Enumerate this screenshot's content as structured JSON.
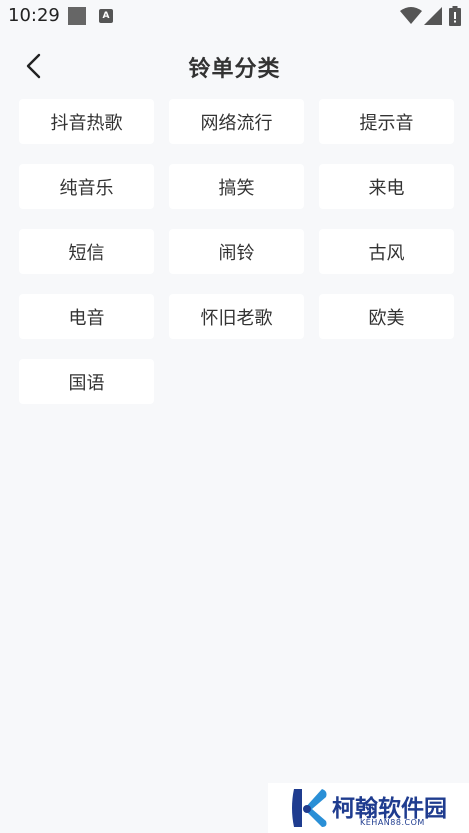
{
  "status_bar": {
    "time": "10:29",
    "notification_letter": "A"
  },
  "header": {
    "title": "铃单分类"
  },
  "categories": [
    {
      "label": "抖音热歌"
    },
    {
      "label": "网络流行"
    },
    {
      "label": "提示音"
    },
    {
      "label": "纯音乐"
    },
    {
      "label": "搞笑"
    },
    {
      "label": "来电"
    },
    {
      "label": "短信"
    },
    {
      "label": "闹铃"
    },
    {
      "label": "古风"
    },
    {
      "label": "电音"
    },
    {
      "label": "怀旧老歌"
    },
    {
      "label": "欧美"
    },
    {
      "label": "国语"
    }
  ],
  "watermark": {
    "name": "柯翰软件园",
    "domain": "KEHAN88.COM",
    "color": "#1f3c8f"
  },
  "colors": {
    "background": "#f7f8fa",
    "card": "#ffffff",
    "text": "#333333"
  }
}
